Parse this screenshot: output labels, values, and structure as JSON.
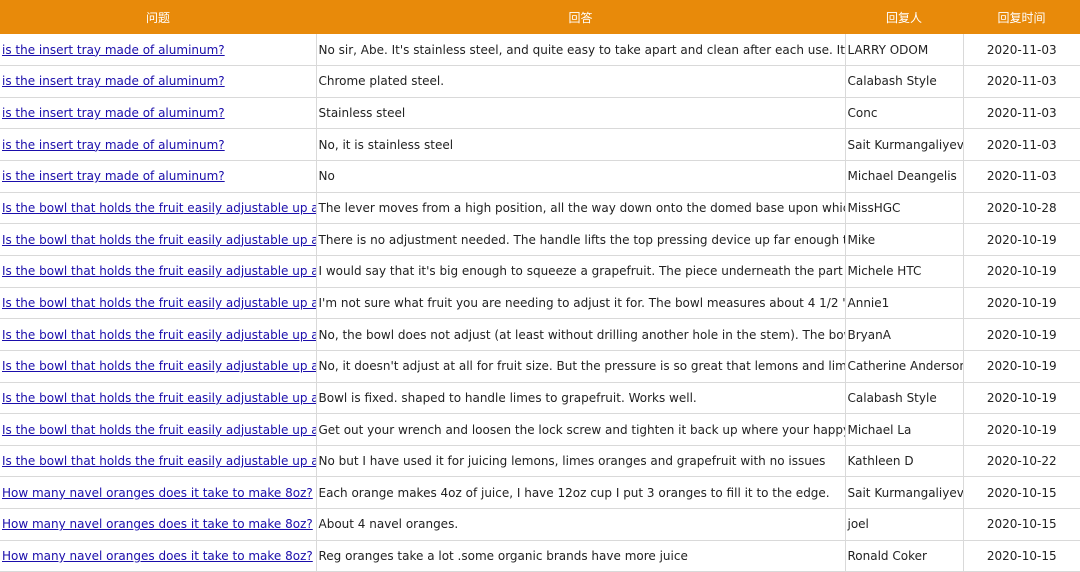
{
  "headers": {
    "question": "问题",
    "answer": "回答",
    "user": "回复人",
    "date": "回复时间"
  },
  "rows": [
    {
      "question": "is the insert tray made of aluminum?",
      "answer": "No sir, Abe. It's stainless steel, and quite easy to take apart and clean after each use. It's an ext",
      "user": "LARRY  ODOM",
      "date": "2020-11-03"
    },
    {
      "question": "is the insert tray made of aluminum?",
      "answer": "Chrome plated steel.",
      "user": "Calabash Style",
      "date": "2020-11-03"
    },
    {
      "question": "is the insert tray made of aluminum?",
      "answer": "Stainless steel",
      "user": "Conc",
      "date": "2020-11-03"
    },
    {
      "question": "is the insert tray made of aluminum?",
      "answer": "No, it is stainless steel",
      "user": "Sait Kurmangaliyev",
      "date": "2020-11-03"
    },
    {
      "question": "is the insert tray made of aluminum?",
      "answer": "No",
      "user": "Michael Deangelis",
      "date": "2020-11-03"
    },
    {
      "question": "Is the bowl that holds the fruit easily adjustable up and d",
      "answer": "The lever moves from a high position, all the way down onto the domed base upon which the l",
      "user": "MissHGC",
      "date": "2020-10-28"
    },
    {
      "question": "Is the bowl that holds the fruit easily adjustable up and d",
      "answer": "There is no adjustment needed. The handle lifts the top pressing device up far enough that any",
      "user": "Mike",
      "date": "2020-10-19"
    },
    {
      "question": "Is the bowl that holds the fruit easily adjustable up and d",
      "answer": "I would say that it's big enough to squeeze a grapefruit. The piece underneath the part that squ",
      "user": "Michele HTC",
      "date": "2020-10-19"
    },
    {
      "question": "Is the bowl that holds the fruit easily adjustable up and d",
      "answer": "I'm not sure what fruit you are needing to adjust it for. The bowl measures about 4 1/2 \" across",
      "user": "Annie1",
      "date": "2020-10-19"
    },
    {
      "question": "Is the bowl that holds the fruit easily adjustable up and d",
      "answer": "No, the bowl does not adjust (at least without drilling another hole in the stem).  The bowl has a",
      "user": "BryanA",
      "date": "2020-10-19"
    },
    {
      "question": "Is the bowl that holds the fruit easily adjustable up and d",
      "answer": "No, it doesn't adjust at all for fruit size. But the pressure is so great that lemons and limes are fu",
      "user": "Catherine Anderson",
      "date": "2020-10-19"
    },
    {
      "question": "Is the bowl that holds the fruit easily adjustable up and d",
      "answer": "Bowl is fixed.  shaped to handle limes to grapefruit.  Works well.",
      "user": "Calabash Style",
      "date": "2020-10-19"
    },
    {
      "question": "Is the bowl that holds the fruit easily adjustable up and d",
      "answer": "Get out your wrench and loosen the lock screw and tighten it back up where your happy.  As ea",
      "user": "Michael La",
      "date": "2020-10-19"
    },
    {
      "question": "Is the bowl that holds the fruit easily adjustable up and d",
      "answer": "No but I have used it for juicing lemons, limes oranges and grapefruit with no issues",
      "user": "Kathleen D",
      "date": "2020-10-22"
    },
    {
      "question": "How many navel oranges does it take to make 8oz?",
      "answer": "Each orange makes 4oz of juice, I have 12oz cup I put 3 oranges to fill it to the edge.",
      "user": "Sait Kurmangaliyev",
      "date": "2020-10-15"
    },
    {
      "question": "How many navel oranges does it take to make 8oz?",
      "answer": "About 4 navel oranges.",
      "user": "joel",
      "date": "2020-10-15"
    },
    {
      "question": "How many navel oranges does it take to make 8oz?",
      "answer": "Reg oranges take a lot .some organic brands have more juice",
      "user": "Ronald Coker",
      "date": "2020-10-15"
    }
  ]
}
